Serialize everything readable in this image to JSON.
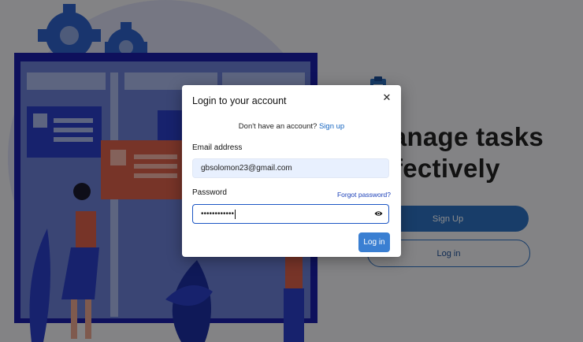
{
  "hero": {
    "title": "Manage tasks\neffectively",
    "signup_label": "Sign Up",
    "login_label": "Log in"
  },
  "modal": {
    "title": "Login to your account",
    "close_glyph": "✕",
    "no_account_text": "Don't have an account?",
    "signup_link": "Sign up",
    "email_label": "Email address",
    "email_value": "gbsolomon23@gmail.com",
    "password_label": "Password",
    "forgot_link": "Forgot password?",
    "password_value": "••••••••••••",
    "submit_label": "Log in"
  },
  "colors": {
    "accent": "#3a7fd2",
    "link": "#1565c0",
    "brand_dark": "#2c6fc0"
  }
}
